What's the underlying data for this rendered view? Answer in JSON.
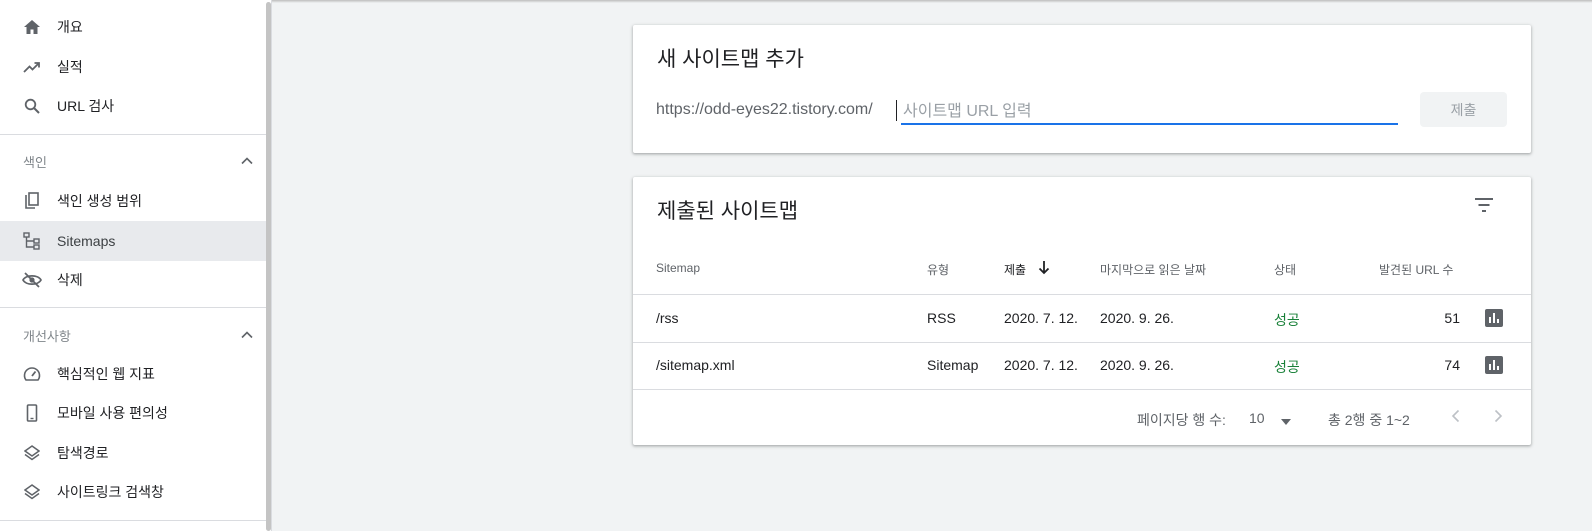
{
  "sidebar": {
    "items": [
      {
        "label": "개요",
        "icon": "home-icon"
      },
      {
        "label": "실적",
        "icon": "trending-up-icon"
      },
      {
        "label": "URL 검사",
        "icon": "search-icon"
      }
    ],
    "index_section": {
      "label": "색인",
      "items": [
        {
          "label": "색인 생성 범위",
          "icon": "copy-pages-icon"
        },
        {
          "label": "Sitemaps",
          "icon": "sitemap-tree-icon",
          "active": true
        },
        {
          "label": "삭제",
          "icon": "eye-off-icon"
        }
      ]
    },
    "enhancements_section": {
      "label": "개선사항",
      "items": [
        {
          "label": "핵심적인 웹 지표",
          "icon": "gauge-icon"
        },
        {
          "label": "모바일 사용 편의성",
          "icon": "smartphone-icon"
        },
        {
          "label": "탐색경로",
          "icon": "layers-icon"
        },
        {
          "label": "사이트링크 검색창",
          "icon": "layers-icon"
        }
      ]
    }
  },
  "add_sitemap": {
    "title": "새 사이트맵 추가",
    "url_prefix": "https://odd-eyes22.tistory.com/",
    "input_value": "",
    "input_placeholder": "사이트맵 URL 입력",
    "submit_label": "제출"
  },
  "submitted": {
    "title": "제출된 사이트맵",
    "columns": [
      "Sitemap",
      "유형",
      "제출",
      "마지막으로 읽은 날짜",
      "상태",
      "발견된 URL 수"
    ],
    "rows": [
      {
        "sitemap": "/rss",
        "type": "RSS",
        "submitted": "2020. 7. 12.",
        "last_read": "2020. 9. 26.",
        "status": "성공",
        "urls": "51"
      },
      {
        "sitemap": "/sitemap.xml",
        "type": "Sitemap",
        "submitted": "2020. 7. 12.",
        "last_read": "2020. 9. 26.",
        "status": "성공",
        "urls": "74"
      }
    ],
    "pagination": {
      "rows_per_page_label": "페이지당 행 수:",
      "rows_per_page": "10",
      "range": "총 2행 중 1~2"
    }
  },
  "colors": {
    "accent": "#1a73e8",
    "success": "#188038",
    "active_bg": "#e8eaed"
  }
}
